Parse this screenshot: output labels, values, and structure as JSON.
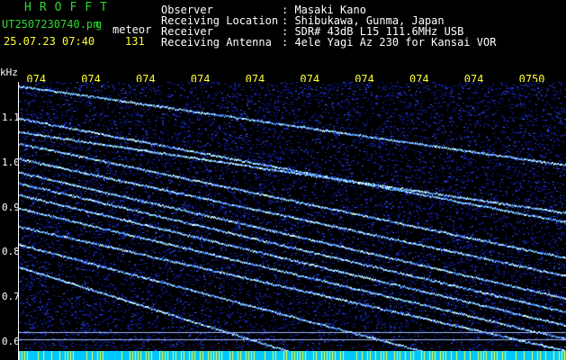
{
  "header": {
    "brand": "HROFFT",
    "filename": "UT2507230740.pn",
    "file_ext": "g",
    "mode": "meteor",
    "datetime": "25.07.23 07:40",
    "count": "131",
    "fields": [
      {
        "label": "Observer",
        "value": ": Masaki Kano"
      },
      {
        "label": "Receiving Location",
        "value": ": Shibukawa, Gunma, Japan"
      },
      {
        "label": "Receiver",
        "value": ": SDR# 43dB L15 111.6MHz USB"
      },
      {
        "label": "Receiving Antenna",
        "value": ": 4ele Yagi Az 230 for Kansai VOR"
      }
    ]
  },
  "axis": {
    "y_unit": "kHz",
    "y_ticks": [
      "1.1",
      "1.0",
      "0.9",
      "0.8",
      "0.7",
      "0.6"
    ],
    "y_values": [
      1.1,
      1.0,
      0.9,
      0.8,
      0.7,
      0.6
    ],
    "y_range": [
      0.58,
      1.18
    ],
    "x_ticks": [
      "074",
      "074",
      "074",
      "074",
      "074",
      "074",
      "074",
      "074",
      "074",
      "0750"
    ],
    "x_values": [
      0.5,
      1.5,
      2.5,
      3.5,
      4.5,
      5.5,
      6.5,
      7.5,
      8.5,
      9.5
    ],
    "x_range": [
      0,
      10
    ]
  },
  "colors": {
    "background": "#000000",
    "noise": "#1a2fd0",
    "trace": "#b6f0ff",
    "bottom_bar": "#00c8ff",
    "bottom_ticks": "#ffff33"
  }
}
